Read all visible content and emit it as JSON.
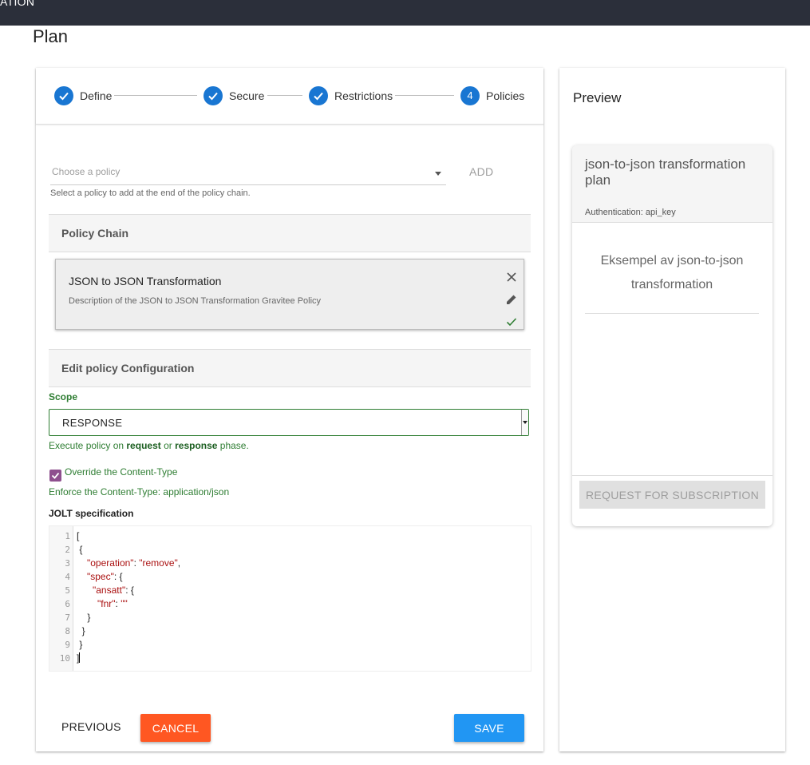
{
  "topbar": {
    "text": "ATION"
  },
  "page": {
    "title": "Plan"
  },
  "stepper": {
    "steps": [
      {
        "label": "Define",
        "state": "done"
      },
      {
        "label": "Secure",
        "state": "done"
      },
      {
        "label": "Restrictions",
        "state": "done"
      },
      {
        "label": "Policies",
        "state": "active",
        "number": "4"
      }
    ]
  },
  "policy_select": {
    "placeholder": "Choose a policy",
    "add_label": "ADD",
    "hint": "Select a policy to add at the end of the policy chain."
  },
  "policy_chain": {
    "heading": "Policy Chain",
    "items": [
      {
        "name": "JSON to JSON Transformation",
        "description": "Description of the JSON to JSON Transformation Gravitee Policy"
      }
    ]
  },
  "config": {
    "heading": "Edit policy Configuration",
    "scope_label": "Scope",
    "scope_value": "RESPONSE",
    "scope_hint_prefix": "Execute policy on ",
    "scope_hint_request": "request",
    "scope_hint_or": " or ",
    "scope_hint_response": "response",
    "scope_hint_suffix": " phase.",
    "override_label": "Override the Content-Type",
    "override_checked": true,
    "enforce_text": "Enforce the Content-Type: application/json",
    "jolt_label": "JOLT specification"
  },
  "editor": {
    "line_numbers": [
      "1",
      "2",
      "3",
      "4",
      "5",
      "6",
      "7",
      "8",
      "9",
      "10"
    ],
    "lines": {
      "l1": "[",
      "l2": " {",
      "l3_key": "\"operation\"",
      "l3_sep": ": ",
      "l3_val": "\"remove\"",
      "l3_end": ",",
      "l4_key": "\"spec\"",
      "l4_end": ": {",
      "l5_key": "\"ansatt\"",
      "l5_end": ": {",
      "l6_key": "\"fnr\"",
      "l6_sep": ": ",
      "l6_val": "\"\"",
      "l7": "    }",
      "l8": "  }",
      "l9": " }",
      "l10": "]"
    }
  },
  "actions": {
    "previous": "PREVIOUS",
    "cancel": "CANCEL",
    "save": "SAVE"
  },
  "preview": {
    "title": "Preview",
    "plan_name": "json-to-json transformation plan",
    "authentication": "Authentication: api_key",
    "description": "Eksempel av json-to-json transformation",
    "subscribe_label": "REQUEST FOR SUBSCRIPTION"
  },
  "colors": {
    "primary": "#1976d2",
    "cancel": "#ff5722",
    "save": "#2196f3",
    "scope": "#2e7d32",
    "checkbox": "#8e4f8e",
    "topbar": "#2b2f3a"
  }
}
